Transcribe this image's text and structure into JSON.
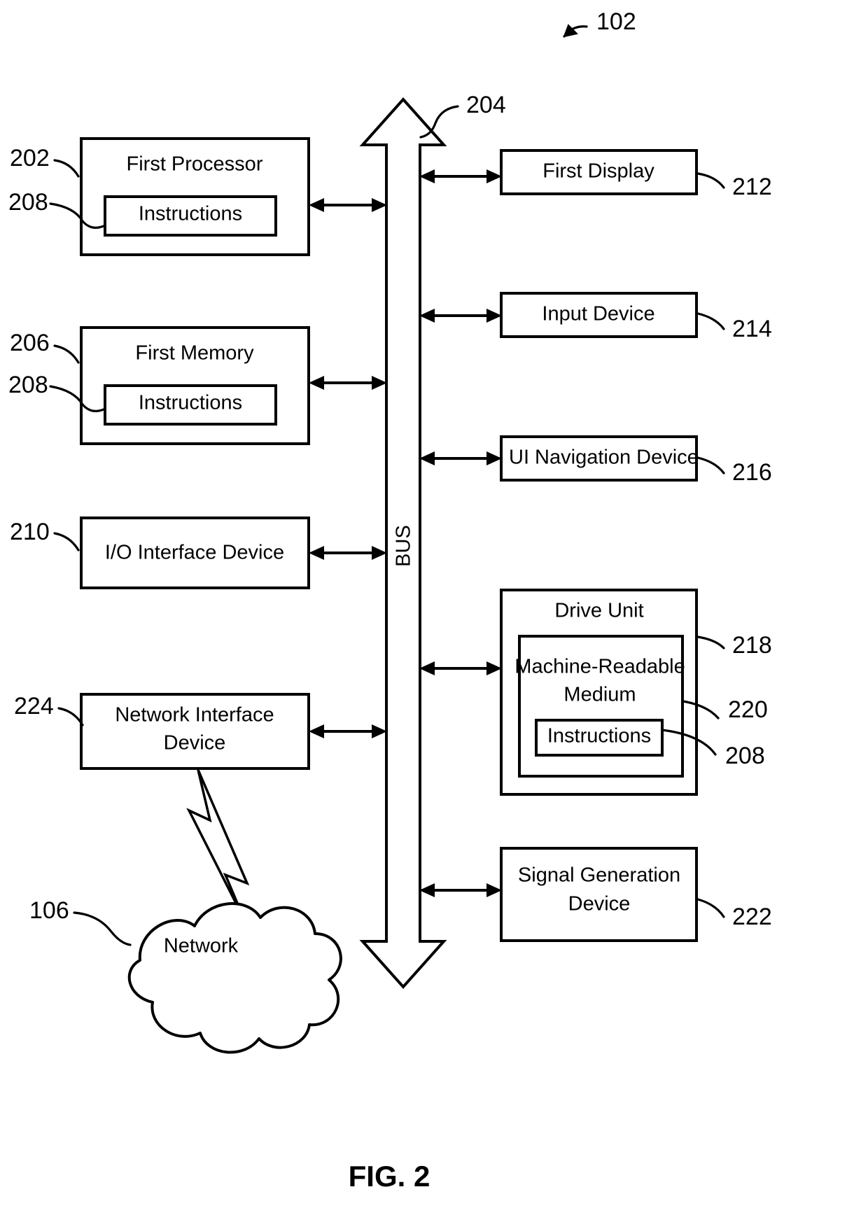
{
  "figure": {
    "caption": "FIG. 2",
    "system_ref": "102"
  },
  "bus": {
    "label": "BUS",
    "ref": "204"
  },
  "left_column": [
    {
      "id": "first-processor",
      "title": "First Processor",
      "ref": "202",
      "inner": {
        "title": "Instructions",
        "ref": "208"
      }
    },
    {
      "id": "first-memory",
      "title": "First Memory",
      "ref": "206",
      "inner": {
        "title": "Instructions",
        "ref": "208"
      }
    },
    {
      "id": "io-interface-device",
      "title": "I/O Interface Device",
      "ref": "210"
    },
    {
      "id": "network-interface-device",
      "title_line1": "Network Interface",
      "title_line2": "Device",
      "ref": "224"
    }
  ],
  "right_column": [
    {
      "id": "first-display",
      "title": "First Display",
      "ref": "212"
    },
    {
      "id": "input-device",
      "title": "Input Device",
      "ref": "214"
    },
    {
      "id": "ui-navigation-device",
      "title": "UI Navigation Device",
      "ref": "216"
    },
    {
      "id": "drive-unit",
      "title": "Drive Unit",
      "ref": "218",
      "inner": {
        "title_line1": "Machine-Readable",
        "title_line2": "Medium",
        "ref": "220",
        "inner": {
          "title": "Instructions",
          "ref": "208"
        }
      }
    },
    {
      "id": "signal-generation-device",
      "title_line1": "Signal Generation",
      "title_line2": "Device",
      "ref": "222"
    }
  ],
  "network": {
    "id": "network-cloud",
    "title": "Network",
    "ref": "106"
  },
  "colors": {
    "stroke": "#000000",
    "background": "#ffffff"
  }
}
